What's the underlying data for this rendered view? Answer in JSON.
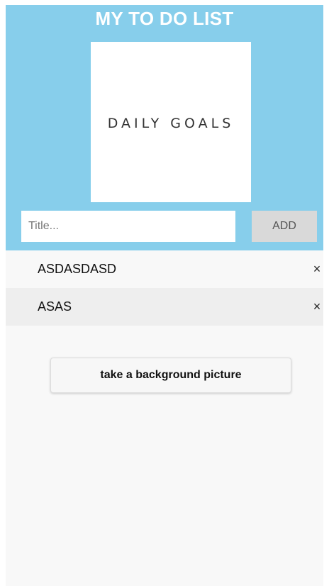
{
  "header": {
    "title": "MY TO DO LIST",
    "logo_text": "DAILY GOALS",
    "background_color": "#87ceeb"
  },
  "form": {
    "title_placeholder": "Title...",
    "title_value": "",
    "add_label": "ADD"
  },
  "todos": [
    {
      "label": "ASDASDASD",
      "remove_icon": "×"
    },
    {
      "label": "ASAS",
      "remove_icon": "×"
    }
  ],
  "actions": {
    "background_button_label": "take a background picture"
  }
}
